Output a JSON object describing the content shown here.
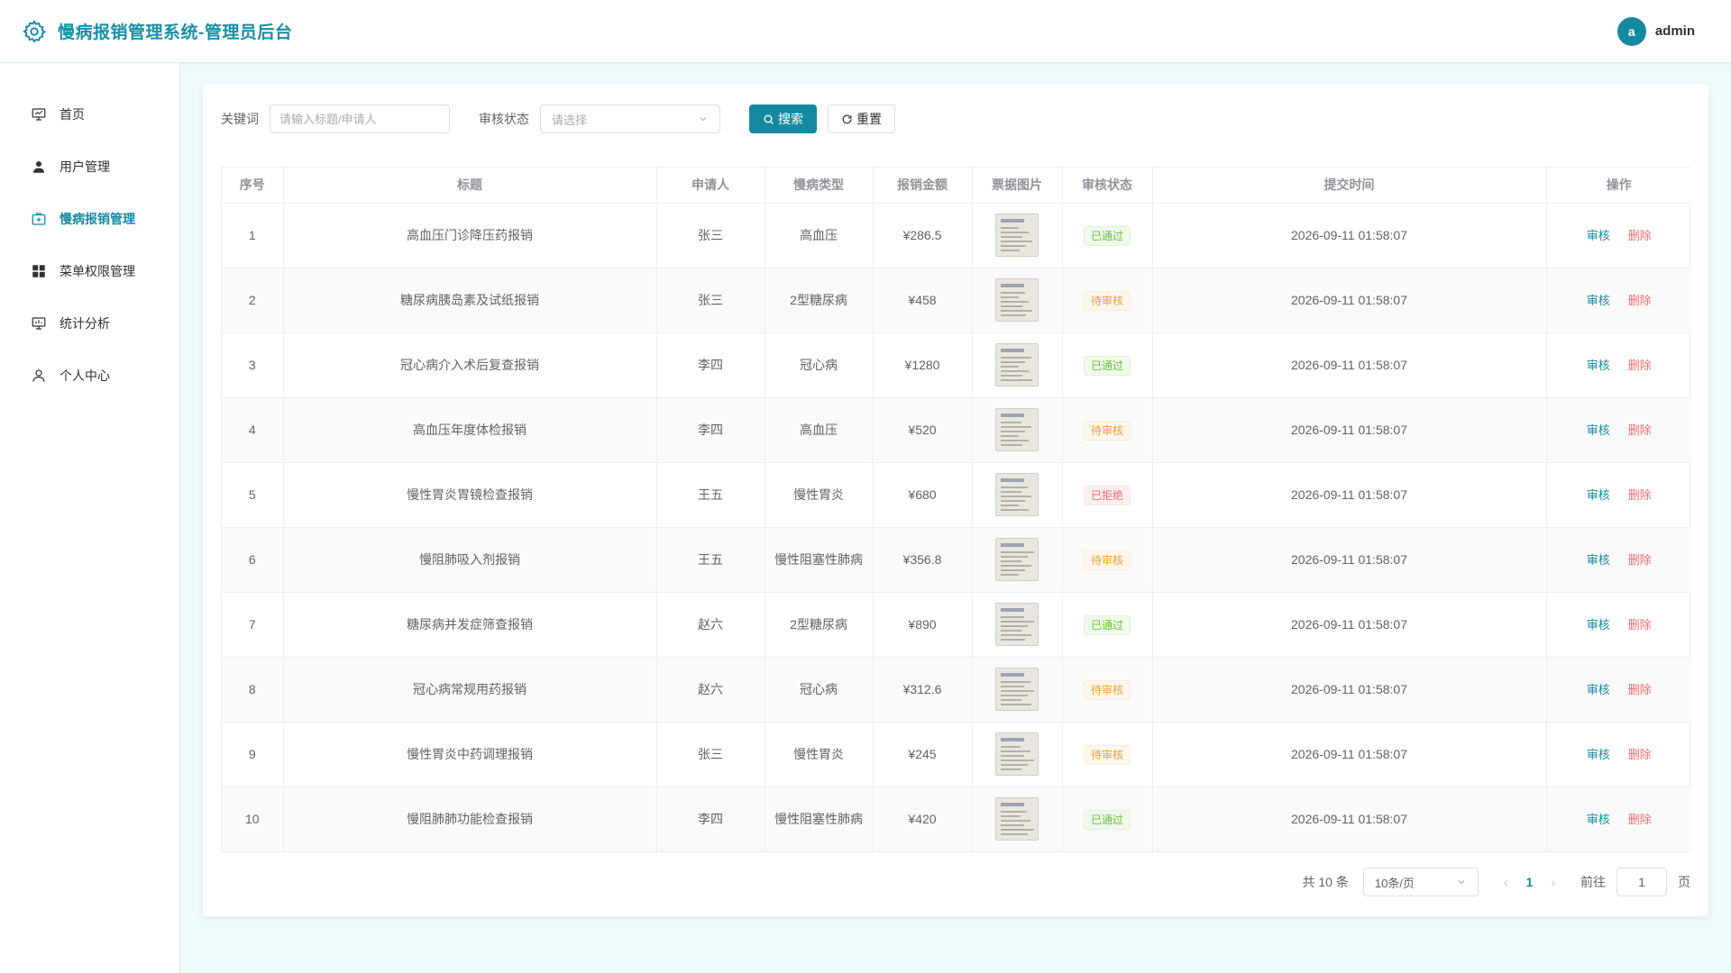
{
  "app": {
    "title": "慢病报销管理系统-管理员后台"
  },
  "user": {
    "avatar_letter": "a",
    "name": "admin"
  },
  "sidebar": {
    "items": [
      {
        "label": "首页",
        "icon": "dashboard-icon",
        "active": false
      },
      {
        "label": "用户管理",
        "icon": "user-icon",
        "active": false
      },
      {
        "label": "慢病报销管理",
        "icon": "medical-box-icon",
        "active": true
      },
      {
        "label": "菜单权限管理",
        "icon": "grid-icon",
        "active": false
      },
      {
        "label": "统计分析",
        "icon": "chart-board-icon",
        "active": false
      },
      {
        "label": "个人中心",
        "icon": "person-icon",
        "active": false
      }
    ]
  },
  "filters": {
    "keyword_label": "关键词",
    "keyword_placeholder": "请输入标题/申请人",
    "status_label": "审核状态",
    "status_placeholder": "请选择",
    "search_label": "搜索",
    "reset_label": "重置"
  },
  "table": {
    "columns": [
      "序号",
      "标题",
      "申请人",
      "慢病类型",
      "报销金额",
      "票据图片",
      "审核状态",
      "提交时间",
      "操作"
    ],
    "rows": [
      {
        "no": "1",
        "title": "高血压门诊降压药报销",
        "applicant": "张三",
        "type": "高血压",
        "amount": "¥286.5",
        "status": "已通过",
        "time": "2026-09-11 01:58:07"
      },
      {
        "no": "2",
        "title": "糖尿病胰岛素及试纸报销",
        "applicant": "张三",
        "type": "2型糖尿病",
        "amount": "¥458",
        "status": "待审核",
        "time": "2026-09-11 01:58:07"
      },
      {
        "no": "3",
        "title": "冠心病介入术后复查报销",
        "applicant": "李四",
        "type": "冠心病",
        "amount": "¥1280",
        "status": "已通过",
        "time": "2026-09-11 01:58:07"
      },
      {
        "no": "4",
        "title": "高血压年度体检报销",
        "applicant": "李四",
        "type": "高血压",
        "amount": "¥520",
        "status": "待审核",
        "time": "2026-09-11 01:58:07"
      },
      {
        "no": "5",
        "title": "慢性胃炎胃镜检查报销",
        "applicant": "王五",
        "type": "慢性胃炎",
        "amount": "¥680",
        "status": "已拒绝",
        "time": "2026-09-11 01:58:07"
      },
      {
        "no": "6",
        "title": "慢阻肺吸入剂报销",
        "applicant": "王五",
        "type": "慢性阻塞性肺病",
        "amount": "¥356.8",
        "status": "待审核",
        "time": "2026-09-11 01:58:07"
      },
      {
        "no": "7",
        "title": "糖尿病并发症筛查报销",
        "applicant": "赵六",
        "type": "2型糖尿病",
        "amount": "¥890",
        "status": "已通过",
        "time": "2026-09-11 01:58:07"
      },
      {
        "no": "8",
        "title": "冠心病常规用药报销",
        "applicant": "赵六",
        "type": "冠心病",
        "amount": "¥312.6",
        "status": "待审核",
        "time": "2026-09-11 01:58:07"
      },
      {
        "no": "9",
        "title": "慢性胃炎中药调理报销",
        "applicant": "张三",
        "type": "慢性胃炎",
        "amount": "¥245",
        "status": "待审核",
        "time": "2026-09-11 01:58:07"
      },
      {
        "no": "10",
        "title": "慢阻肺肺功能检查报销",
        "applicant": "李四",
        "type": "慢性阻塞性肺病",
        "amount": "¥420",
        "status": "已通过",
        "time": "2026-09-11 01:58:07"
      }
    ],
    "actions": {
      "review": "审核",
      "delete": "删除"
    }
  },
  "pagination": {
    "total_text": "共 10 条",
    "page_size": "10条/页",
    "current_page": "1",
    "goto_label": "前往",
    "goto_value": "1",
    "page_unit": "页"
  },
  "colors": {
    "primary": "#1589a0",
    "pass": "#67c23a",
    "pending": "#e6a23c",
    "reject": "#f56c6c"
  }
}
